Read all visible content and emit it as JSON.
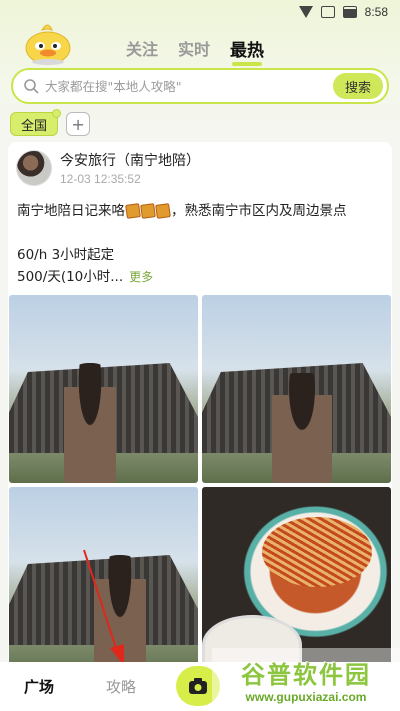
{
  "status_bar": {
    "time": "8:58"
  },
  "header": {
    "tabs": [
      {
        "label": "关注"
      },
      {
        "label": "实时"
      },
      {
        "label": "最热",
        "active": true
      }
    ]
  },
  "search": {
    "placeholder": "大家都在搜\"本地人攻略\"",
    "button": "搜索"
  },
  "filters": {
    "chips": [
      {
        "label": "全国",
        "active": true
      }
    ],
    "add_label": "+"
  },
  "post": {
    "author": "今安旅行（南宁地陪）",
    "time": "12-03 12:35:52",
    "text_line1_before": "南宁地陪日记来咯",
    "text_line1_after": "，熟悉南宁市区内及周边景点",
    "text_line2": "60/h 3小时起定",
    "text_line3": "500/天(10小时...",
    "more": "更多",
    "images": [
      {
        "subject": "woman-on-rooftop-city"
      },
      {
        "subject": "woman-on-rooftop-skyline"
      },
      {
        "subject": "woman-rooftop-phone"
      },
      {
        "subject": "spicy-noodles-bowl"
      }
    ]
  },
  "bottom_nav": {
    "items": [
      {
        "label": "广场",
        "active": true
      },
      {
        "label": "攻略",
        "active": false
      }
    ]
  },
  "watermark": {
    "title": "谷普软件园",
    "url": "www.gupuxiazai.com"
  },
  "colors": {
    "accent": "#c8e64a",
    "more_link": "#7aa83a",
    "arrow": "#e0271b"
  }
}
